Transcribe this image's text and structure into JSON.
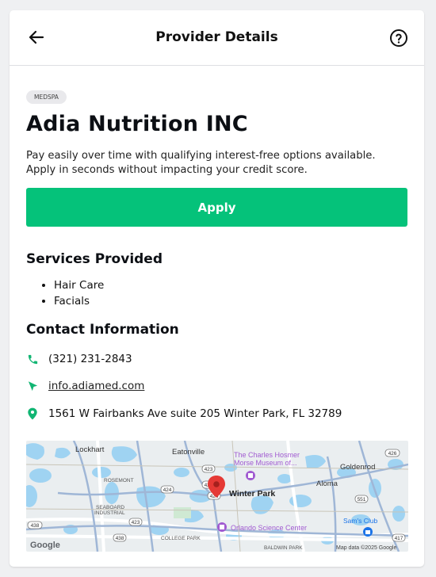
{
  "header": {
    "title": "Provider Details",
    "back_icon": "back-arrow-icon",
    "help_icon": "help-circle-icon"
  },
  "provider": {
    "category": "MEDSPA",
    "name": "Adia Nutrition INC",
    "description": "Pay easily over time with qualifying interest-free options available. Apply in seconds without impacting your credit score.",
    "apply_label": "Apply"
  },
  "services": {
    "heading": "Services Provided",
    "items": [
      "Hair Care",
      "Facials"
    ]
  },
  "contact": {
    "heading": "Contact Information",
    "phone": "(321) 231-2843",
    "website": "info.adiamed.com",
    "address": "1561 W Fairbanks Ave suite 205 Winter Park, FL 32789"
  },
  "map": {
    "labels": {
      "lockhart": "Lockhart",
      "eatonville": "Eatonville",
      "museum_line1": "The Charles Hosmer",
      "museum_line2": "Morse Museum of...",
      "goldenrod": "Goldenrod",
      "rosemont": "ROSEMONT",
      "aloma": "Aloma",
      "winter_park": "Winter Park",
      "seaboard1": "SEABOARD",
      "seaboard2": "INDUSTRIAL",
      "science_center": "Orlando Science Center",
      "sams_club": "Sam's Club",
      "college_park": "COLLEGE PARK",
      "baldwin_park": "BALDWIN PARK",
      "google": "Google",
      "attribution": "Map data ©2025 Google"
    },
    "road_shields": [
      "426",
      "423",
      "424",
      "423",
      "424",
      "551",
      "438",
      "423",
      "438",
      "417"
    ]
  },
  "colors": {
    "accent": "#05c27a",
    "icon_green": "#11b573",
    "pin_red": "#e53935",
    "poi_purple": "#a15bd1",
    "water": "#9fd3f2"
  }
}
